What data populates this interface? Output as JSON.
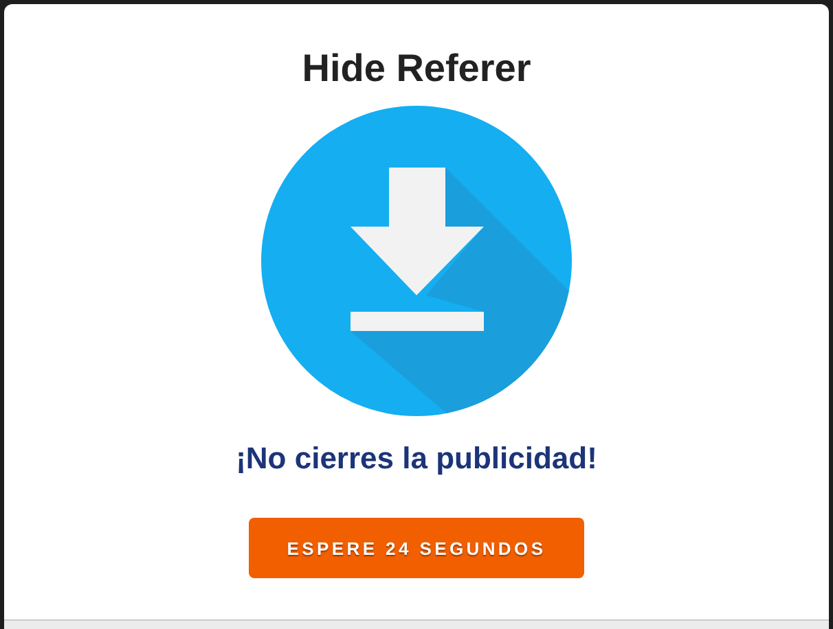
{
  "title": "Hide Referer",
  "notice": "¡No cierres la publicidad!",
  "button": {
    "label": "ESPERE 24 SEGUNDOS"
  }
}
